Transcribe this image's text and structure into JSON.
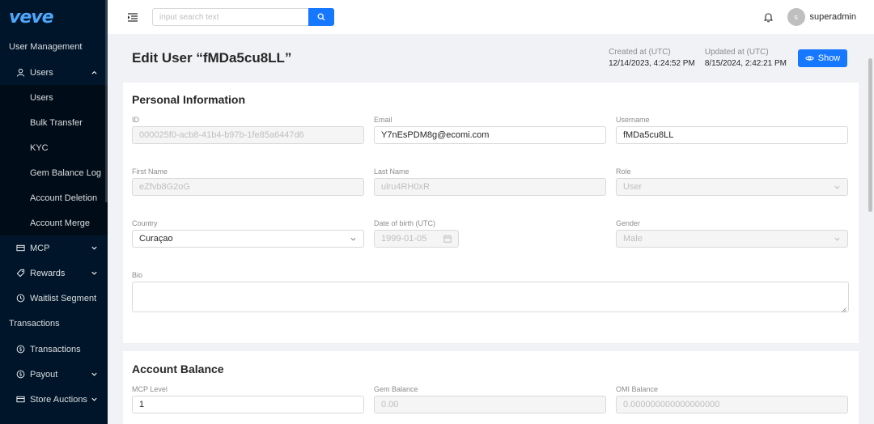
{
  "brand": {
    "logo_text": "veve",
    "logo_color": "#4fa8ff"
  },
  "colors": {
    "sidebar_bg": "#001529",
    "submenu_bg": "#000c17",
    "primary": "#1677ff"
  },
  "sidebar": {
    "group_user_management": "User Management",
    "users_menu": {
      "label": "Users",
      "icon": "user-icon",
      "expanded": true
    },
    "users_submenu": [
      "Users",
      "Bulk Transfer",
      "KYC",
      "Gem Balance Log",
      "Account Deletion",
      "Account Merge"
    ],
    "mcp": {
      "label": "MCP",
      "icon": "card-icon"
    },
    "rewards": {
      "label": "Rewards",
      "icon": "tag-icon"
    },
    "waitlist": {
      "label": "Waitlist Segment",
      "icon": "clock-icon"
    },
    "group_transactions": "Transactions",
    "transactions": {
      "label": "Transactions",
      "icon": "dollar-circle-icon"
    },
    "payout": {
      "label": "Payout",
      "icon": "dollar-circle-icon"
    },
    "store_auctions": {
      "label": "Store Auctions",
      "icon": "card-icon"
    }
  },
  "header": {
    "search_placeholder": "input search text",
    "avatar_letter": "s",
    "username": "superadmin"
  },
  "page": {
    "title": "Edit User “fMDa5cu8LL”",
    "created_label": "Created at (UTC)",
    "created_value": "12/14/2023, 4:24:52 PM",
    "updated_label": "Updated at (UTC)",
    "updated_value": "8/15/2024, 2:42:21 PM",
    "show_button": "Show"
  },
  "personal": {
    "title": "Personal Information",
    "id": {
      "label": "ID",
      "value": "000025f0-acb8-41b4-b97b-1fe85a6447d6"
    },
    "email": {
      "label": "Email",
      "value": "Y7nEsPDM8g@ecomi.com"
    },
    "username": {
      "label": "Username",
      "value": "fMDa5cu8LL"
    },
    "first_name": {
      "label": "First Name",
      "value": "eZfvb8G2oG"
    },
    "last_name": {
      "label": "Last Name",
      "value": "ulru4RH0xR"
    },
    "role": {
      "label": "Role",
      "value": "User"
    },
    "country": {
      "label": "Country",
      "value": "Curaçao"
    },
    "dob": {
      "label": "Date of birth (UTC)",
      "value": "1999-01-05"
    },
    "gender": {
      "label": "Gender",
      "value": "Male"
    },
    "bio": {
      "label": "Bio",
      "value": ""
    }
  },
  "balance": {
    "title": "Account Balance",
    "mcp_level": {
      "label": "MCP Level",
      "value": "1"
    },
    "gem_balance": {
      "label": "Gem Balance",
      "value": "0.00"
    },
    "omi_balance": {
      "label": "OMI Balance",
      "value": "0.000000000000000000"
    }
  }
}
